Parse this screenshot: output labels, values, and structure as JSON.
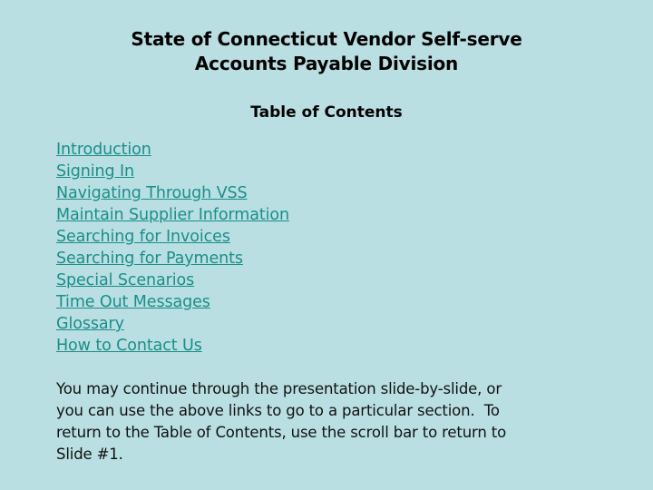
{
  "colors": {
    "background": "#b9dfe3",
    "link": "#1a8f88",
    "text": "#000000"
  },
  "title": {
    "line1": "State of Connecticut Vendor Self-serve",
    "line2": "Accounts Payable Division"
  },
  "toc": {
    "heading": "Table of Contents",
    "items": [
      {
        "label": "Introduction"
      },
      {
        "label": "Signing In"
      },
      {
        "label": "Navigating Through VSS"
      },
      {
        "label": "Maintain Supplier Information"
      },
      {
        "label": "Searching for Invoices"
      },
      {
        "label": "Searching for Payments"
      },
      {
        "label": "Special Scenarios"
      },
      {
        "label": "Time Out Messages"
      },
      {
        "label": "Glossary"
      },
      {
        "label": "How to Contact Us"
      }
    ]
  },
  "instructions": {
    "line1": "You may continue through the presentation slide-by-slide, or",
    "line2": "you can use the above links to go to a particular section.  To",
    "line3": "return to the Table of Contents, use the scroll bar to return to",
    "line4": "Slide #1."
  }
}
